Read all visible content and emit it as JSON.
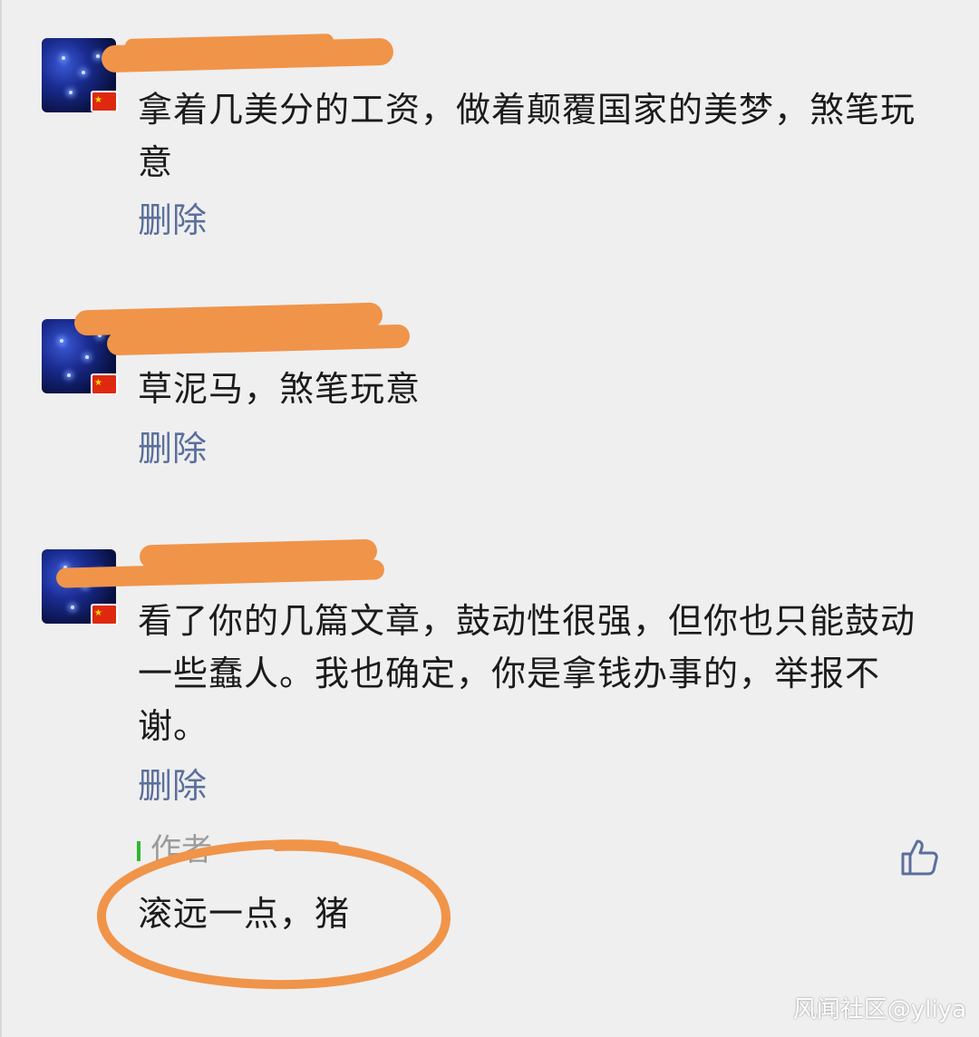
{
  "comments": [
    {
      "text": "拿着几美分的工资，做着颠覆国家的美梦，煞笔玩意",
      "delete_label": "删除"
    },
    {
      "text": "草泥马，煞笔玩意",
      "delete_label": "删除"
    },
    {
      "text": "看了你的几篇文章，鼓动性很强，但你也只能鼓动一些蠢人。我也确定，你是拿钱办事的，举报不谢。",
      "delete_label": "删除"
    }
  ],
  "author_reply": {
    "label": "作者",
    "text": "滚远一点，猪"
  },
  "flag_glyph": "★",
  "watermark": "风闻社区@yliya",
  "colors": {
    "background": "#efefef",
    "text": "#1b1b1b",
    "delete_link": "#5b6f9c",
    "author_bar": "#2eb82e",
    "scribble": "#f0944a"
  },
  "icons": {
    "like": "thumbs-up-icon",
    "flag": "china-flag-icon"
  }
}
